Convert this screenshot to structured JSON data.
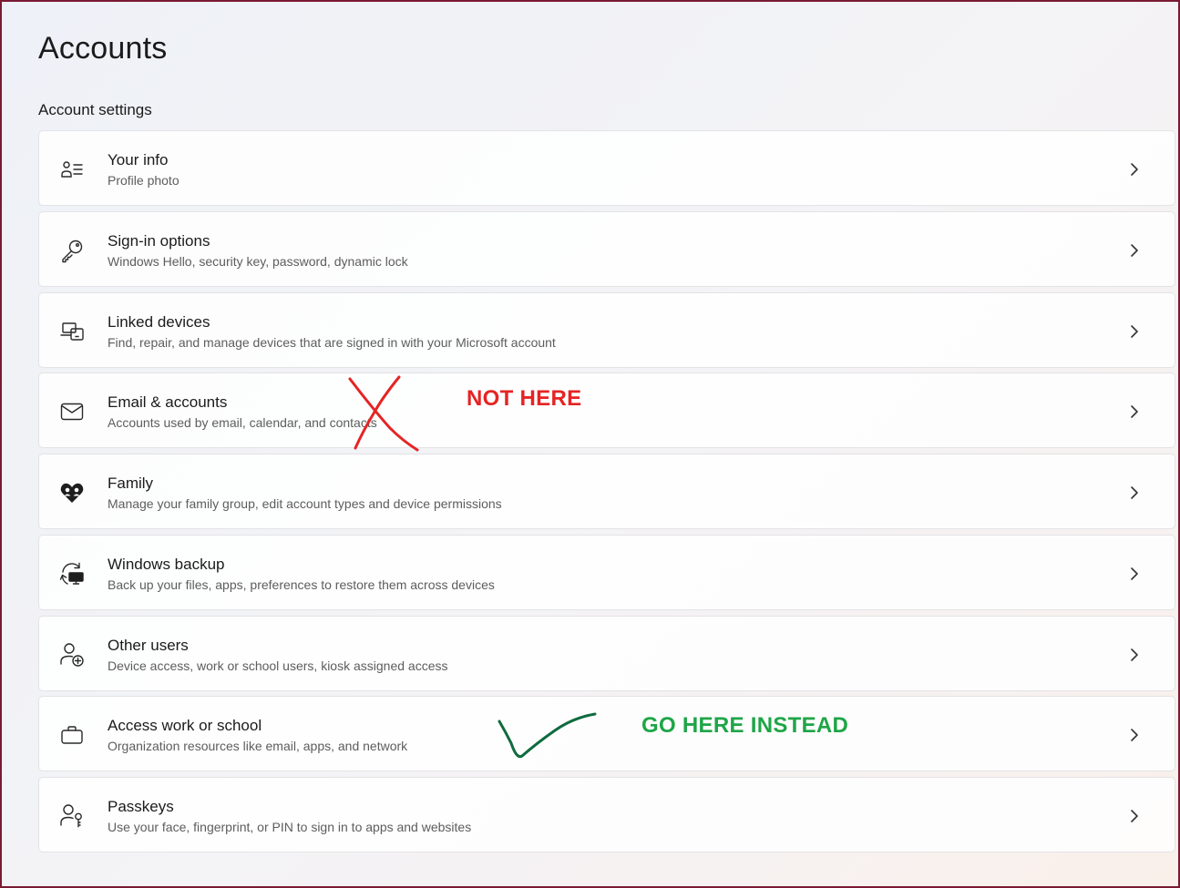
{
  "page_title": "Accounts",
  "section_title": "Account settings",
  "items": [
    {
      "label": "Your info",
      "description": "Profile photo",
      "icon": "user-info-icon"
    },
    {
      "label": "Sign-in options",
      "description": "Windows Hello, security key, password, dynamic lock",
      "icon": "key-icon"
    },
    {
      "label": "Linked devices",
      "description": "Find, repair, and manage devices that are signed in with your Microsoft account",
      "icon": "devices-icon"
    },
    {
      "label": "Email & accounts",
      "description": "Accounts used by email, calendar, and contacts",
      "icon": "mail-icon"
    },
    {
      "label": "Family",
      "description": "Manage your family group, edit account types and device permissions",
      "icon": "family-heart-icon"
    },
    {
      "label": "Windows backup",
      "description": "Back up your files, apps, preferences to restore them across devices",
      "icon": "backup-icon"
    },
    {
      "label": "Other users",
      "description": "Device access, work or school users, kiosk assigned access",
      "icon": "add-user-icon"
    },
    {
      "label": "Access work or school",
      "description": "Organization resources like email, apps, and network",
      "icon": "briefcase-icon"
    },
    {
      "label": "Passkeys",
      "description": "Use your face, fingerprint, or PIN to sign in to apps and websites",
      "icon": "passkey-icon"
    }
  ],
  "annotations": {
    "not_here": "NOT HERE",
    "go_here": "GO HERE INSTEAD",
    "not_here_color": "#e52424",
    "go_here_color": "#1fa548"
  },
  "colors": {
    "frame": "#7a1a33",
    "card_border": "#e3e3e6",
    "text_primary": "#1b1b1b",
    "text_secondary": "#5d5d5d"
  }
}
